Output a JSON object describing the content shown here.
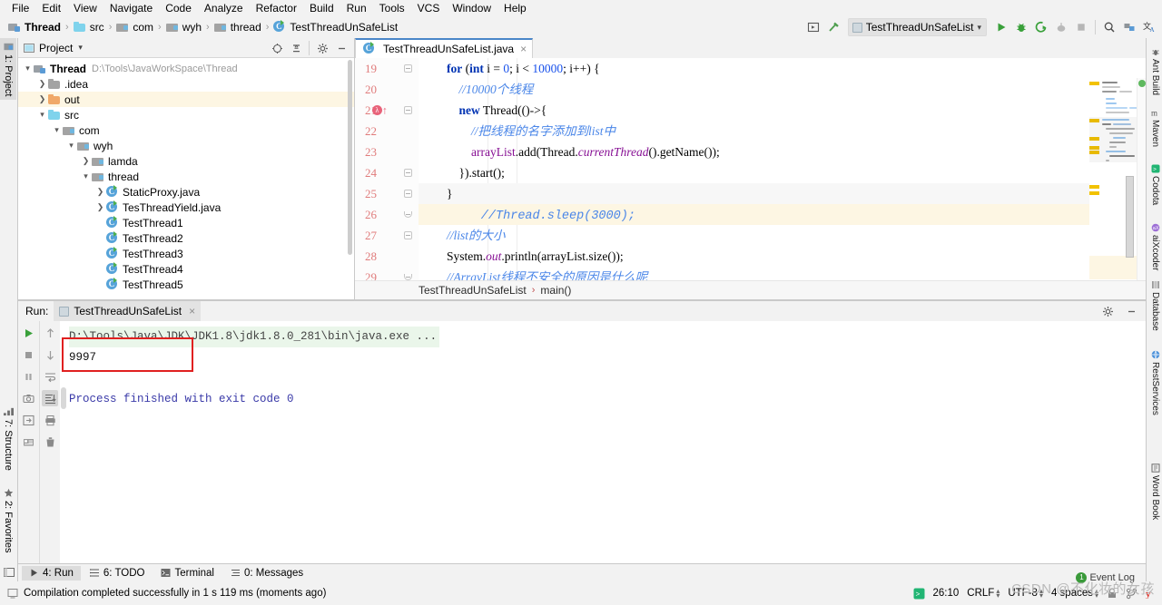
{
  "menu": {
    "items": [
      "File",
      "Edit",
      "View",
      "Navigate",
      "Code",
      "Analyze",
      "Refactor",
      "Build",
      "Run",
      "Tools",
      "VCS",
      "Window",
      "Help"
    ]
  },
  "breadcrumb": {
    "items": [
      "Thread",
      "src",
      "com",
      "wyh",
      "thread",
      "TestThreadUnSafeList"
    ]
  },
  "toolbar": {
    "run_config": "TestThreadUnSafeList",
    "icons": [
      "preview-icon",
      "build-hammer-icon",
      "run-icon",
      "debug-icon",
      "run-coverage-icon",
      "profile-icon",
      "stop-icon",
      "search-icon",
      "project-structure-icon",
      "translate-icon"
    ]
  },
  "left_strip": {
    "tabs": [
      {
        "label": "1: Project",
        "active": true
      },
      {
        "label": "7: Structure",
        "active": false
      },
      {
        "label": "2: Favorites",
        "active": false
      }
    ]
  },
  "right_strip": {
    "tabs": [
      "Ant Build",
      "Maven",
      "Codota",
      "aiXcoder",
      "Database",
      "RestServices",
      "Word Book"
    ]
  },
  "project_panel": {
    "title": "Project",
    "header_icons": [
      "locate-icon",
      "collapse-all-icon",
      "settings-gear-icon",
      "hide-icon"
    ],
    "tree": [
      {
        "label": "Thread",
        "path": "D:\\Tools\\JavaWorkSpace\\Thread",
        "indent": 0,
        "arrow": "down",
        "icon": "module-icon",
        "bold": true,
        "highlight": false
      },
      {
        "label": ".idea",
        "path": "",
        "indent": 1,
        "arrow": "right",
        "icon": "folder-icon",
        "bold": false,
        "highlight": false
      },
      {
        "label": "out",
        "path": "",
        "indent": 1,
        "arrow": "right",
        "icon": "out-folder-icon",
        "bold": false,
        "highlight": true
      },
      {
        "label": "src",
        "path": "",
        "indent": 1,
        "arrow": "down",
        "icon": "source-folder-icon",
        "bold": false,
        "highlight": false
      },
      {
        "label": "com",
        "path": "",
        "indent": 2,
        "arrow": "down",
        "icon": "package-icon",
        "bold": false,
        "highlight": false
      },
      {
        "label": "wyh",
        "path": "",
        "indent": 3,
        "arrow": "down",
        "icon": "package-icon",
        "bold": false,
        "highlight": false
      },
      {
        "label": "lamda",
        "path": "",
        "indent": 4,
        "arrow": "right",
        "icon": "package-icon",
        "bold": false,
        "highlight": false
      },
      {
        "label": "thread",
        "path": "",
        "indent": 4,
        "arrow": "down",
        "icon": "package-icon",
        "bold": false,
        "highlight": false
      },
      {
        "label": "StaticProxy.java",
        "path": "",
        "indent": 5,
        "arrow": "right",
        "icon": "java-class-icon",
        "bold": false,
        "highlight": false
      },
      {
        "label": "TesThreadYield.java",
        "path": "",
        "indent": 5,
        "arrow": "right",
        "icon": "java-class-icon",
        "bold": false,
        "highlight": false
      },
      {
        "label": "TestThread1",
        "path": "",
        "indent": 5,
        "arrow": "none",
        "icon": "java-class-icon",
        "bold": false,
        "highlight": false
      },
      {
        "label": "TestThread2",
        "path": "",
        "indent": 5,
        "arrow": "none",
        "icon": "java-class-icon",
        "bold": false,
        "highlight": false
      },
      {
        "label": "TestThread3",
        "path": "",
        "indent": 5,
        "arrow": "none",
        "icon": "java-class-icon",
        "bold": false,
        "highlight": false
      },
      {
        "label": "TestThread4",
        "path": "",
        "indent": 5,
        "arrow": "none",
        "icon": "java-class-icon",
        "bold": false,
        "highlight": false
      },
      {
        "label": "TestThread5",
        "path": "",
        "indent": 5,
        "arrow": "none",
        "icon": "java-class-icon",
        "bold": false,
        "highlight": false
      }
    ]
  },
  "editor": {
    "tab": {
      "label": "TestThreadUnSafeList.java",
      "close": "×"
    },
    "breadcrumb": {
      "class": "TestThreadUnSafeList",
      "method": "main()",
      "separator": "›"
    },
    "first_line_number": 19,
    "lines": [
      {
        "num": 19,
        "fold": "open",
        "marker": "",
        "highlight": "none",
        "tokens": [
          {
            "t": "        ",
            "c": ""
          },
          {
            "t": "for",
            "c": "kw"
          },
          {
            "t": " (",
            "c": ""
          },
          {
            "t": "int",
            "c": "kw"
          },
          {
            "t": " i = ",
            "c": ""
          },
          {
            "t": "0",
            "c": "num"
          },
          {
            "t": "; i < ",
            "c": ""
          },
          {
            "t": "10000",
            "c": "num"
          },
          {
            "t": "; i++) {",
            "c": ""
          }
        ]
      },
      {
        "num": 20,
        "fold": "none",
        "marker": "",
        "highlight": "none",
        "tokens": [
          {
            "t": "            //10000个线程",
            "c": "cmt"
          }
        ]
      },
      {
        "num": 21,
        "fold": "open",
        "marker": "lambda",
        "highlight": "none",
        "tokens": [
          {
            "t": "            ",
            "c": ""
          },
          {
            "t": "new",
            "c": "kw"
          },
          {
            "t": " Thread(()->{",
            "c": ""
          }
        ]
      },
      {
        "num": 22,
        "fold": "none",
        "marker": "",
        "highlight": "none",
        "tokens": [
          {
            "t": "                //把线程的名字添加到list中",
            "c": "cmt"
          }
        ]
      },
      {
        "num": 23,
        "fold": "none",
        "marker": "",
        "highlight": "none",
        "tokens": [
          {
            "t": "                ",
            "c": ""
          },
          {
            "t": "arrayList",
            "c": "ivar"
          },
          {
            "t": ".add(Thread.",
            "c": ""
          },
          {
            "t": "currentThread",
            "c": "fld"
          },
          {
            "t": "().getName());",
            "c": ""
          }
        ]
      },
      {
        "num": 24,
        "fold": "open",
        "marker": "",
        "highlight": "none",
        "tokens": [
          {
            "t": "            }).start();",
            "c": ""
          }
        ]
      },
      {
        "num": 25,
        "fold": "open",
        "marker": "",
        "highlight": "gray",
        "tokens": [
          {
            "t": "        }",
            "c": ""
          }
        ]
      },
      {
        "num": 26,
        "fold": "round",
        "marker": "",
        "highlight": "yellow",
        "tokens": [
          {
            "t": "        //Thread.sleep(3000);",
            "c": "cmt-mono"
          }
        ]
      },
      {
        "num": 27,
        "fold": "open",
        "marker": "",
        "highlight": "none",
        "tokens": [
          {
            "t": "        //list的大小",
            "c": "cmt"
          }
        ]
      },
      {
        "num": 28,
        "fold": "none",
        "marker": "",
        "highlight": "none",
        "tokens": [
          {
            "t": "        System.",
            "c": ""
          },
          {
            "t": "out",
            "c": "fld"
          },
          {
            "t": ".println(arrayList.size());",
            "c": ""
          }
        ]
      },
      {
        "num": 29,
        "fold": "round",
        "marker": "",
        "highlight": "none",
        "tokens": [
          {
            "t": "        //ArrayList线程不安全的原因是什么呢",
            "c": "cmt"
          }
        ]
      }
    ]
  },
  "run_panel": {
    "label": "Run:",
    "tab": "TestThreadUnSafeList",
    "tab_close": "×",
    "header_icons": [
      "settings-gear-icon",
      "hide-icon"
    ],
    "toolbar_left_icons": [
      "rerun-icon",
      "stop-icon",
      "pause-icon",
      "camera-icon",
      "export-icon",
      "console-icon"
    ],
    "toolbar_right_icons": [
      "up-arrow-icon",
      "down-arrow-icon",
      "soft-wrap-icon",
      "scroll-to-end-icon",
      "print-icon",
      "trash-icon"
    ],
    "console": {
      "command": "D:\\Tools\\Java\\JDK\\JDK1.8\\jdk1.8.0_281\\bin\\java.exe ...",
      "output": "9997",
      "finished": "Process finished with exit code 0"
    }
  },
  "bottom_tabs": [
    {
      "label": "4: Run",
      "icon": "run-icon",
      "active": true
    },
    {
      "label": "6: TODO",
      "icon": "todo-icon",
      "active": false
    },
    {
      "label": "Terminal",
      "icon": "terminal-icon",
      "active": false
    },
    {
      "label": "0: Messages",
      "icon": "messages-icon",
      "active": false
    }
  ],
  "status_bar": {
    "message": "Compilation completed successfully in 1 s 119 ms (moments ago)",
    "caret": "26:10",
    "line_separator": "CRLF",
    "encoding": "UTF-8",
    "indent": "4 spaces",
    "event_log": "Event Log",
    "event_count": "1"
  },
  "watermark": "CSDN @不化妆的女孩",
  "colors": {
    "accent_blue": "#4a86c8",
    "keyword": "#0033b3",
    "comment": "#4a86e8",
    "number": "#1750eb",
    "field": "#871094",
    "red_box": "#e02020",
    "line_number": "#e07b7b",
    "highlight_yellow": "#fdf6e3",
    "console_cmd_bg": "#eaf6ea",
    "console_finish": "#3a3aa8"
  }
}
